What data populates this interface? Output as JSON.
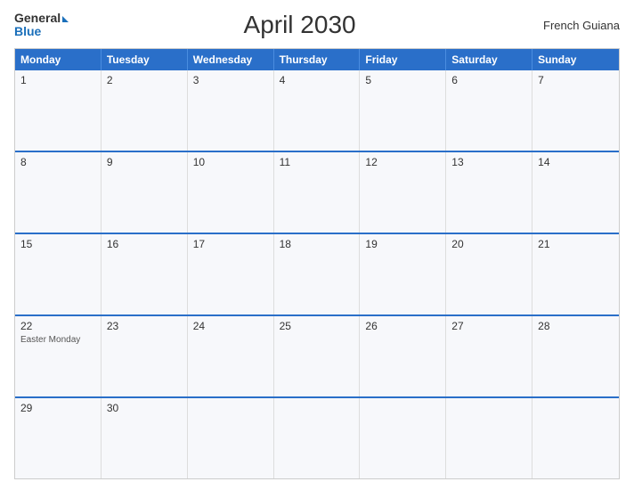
{
  "header": {
    "logo_general": "General",
    "logo_blue": "Blue",
    "title": "April 2030",
    "region": "French Guiana"
  },
  "calendar": {
    "days_of_week": [
      "Monday",
      "Tuesday",
      "Wednesday",
      "Thursday",
      "Friday",
      "Saturday",
      "Sunday"
    ],
    "weeks": [
      [
        {
          "day": "1",
          "event": ""
        },
        {
          "day": "2",
          "event": ""
        },
        {
          "day": "3",
          "event": ""
        },
        {
          "day": "4",
          "event": ""
        },
        {
          "day": "5",
          "event": ""
        },
        {
          "day": "6",
          "event": ""
        },
        {
          "day": "7",
          "event": ""
        }
      ],
      [
        {
          "day": "8",
          "event": ""
        },
        {
          "day": "9",
          "event": ""
        },
        {
          "day": "10",
          "event": ""
        },
        {
          "day": "11",
          "event": ""
        },
        {
          "day": "12",
          "event": ""
        },
        {
          "day": "13",
          "event": ""
        },
        {
          "day": "14",
          "event": ""
        }
      ],
      [
        {
          "day": "15",
          "event": ""
        },
        {
          "day": "16",
          "event": ""
        },
        {
          "day": "17",
          "event": ""
        },
        {
          "day": "18",
          "event": ""
        },
        {
          "day": "19",
          "event": ""
        },
        {
          "day": "20",
          "event": ""
        },
        {
          "day": "21",
          "event": ""
        }
      ],
      [
        {
          "day": "22",
          "event": "Easter Monday"
        },
        {
          "day": "23",
          "event": ""
        },
        {
          "day": "24",
          "event": ""
        },
        {
          "day": "25",
          "event": ""
        },
        {
          "day": "26",
          "event": ""
        },
        {
          "day": "27",
          "event": ""
        },
        {
          "day": "28",
          "event": ""
        }
      ],
      [
        {
          "day": "29",
          "event": ""
        },
        {
          "day": "30",
          "event": ""
        },
        {
          "day": "",
          "event": ""
        },
        {
          "day": "",
          "event": ""
        },
        {
          "day": "",
          "event": ""
        },
        {
          "day": "",
          "event": ""
        },
        {
          "day": "",
          "event": ""
        }
      ]
    ]
  }
}
